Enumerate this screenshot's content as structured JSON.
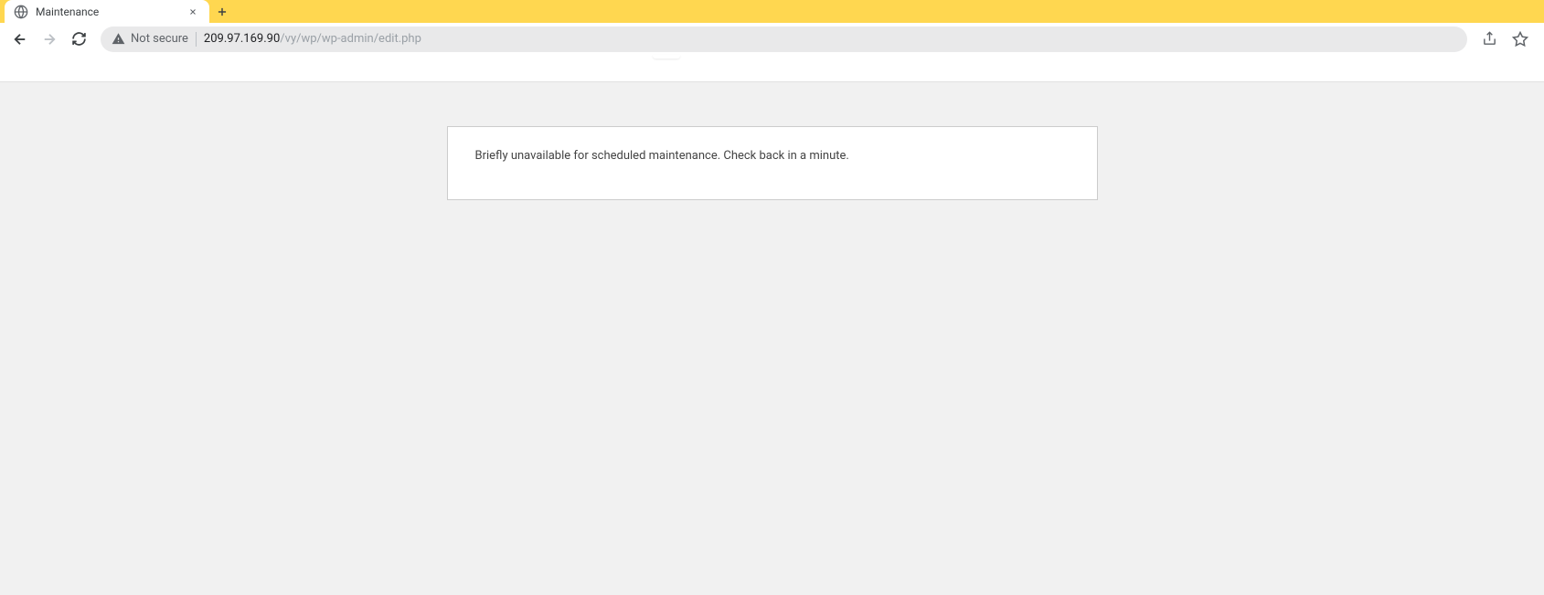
{
  "tab": {
    "title": "Maintenance"
  },
  "toolbar": {
    "security_label": "Not secure",
    "url_host": "209.97.169.90",
    "url_path": "/vy/wp/wp-admin/edit.php"
  },
  "page": {
    "maintenance_message": "Briefly unavailable for scheduled maintenance. Check back in a minute."
  }
}
